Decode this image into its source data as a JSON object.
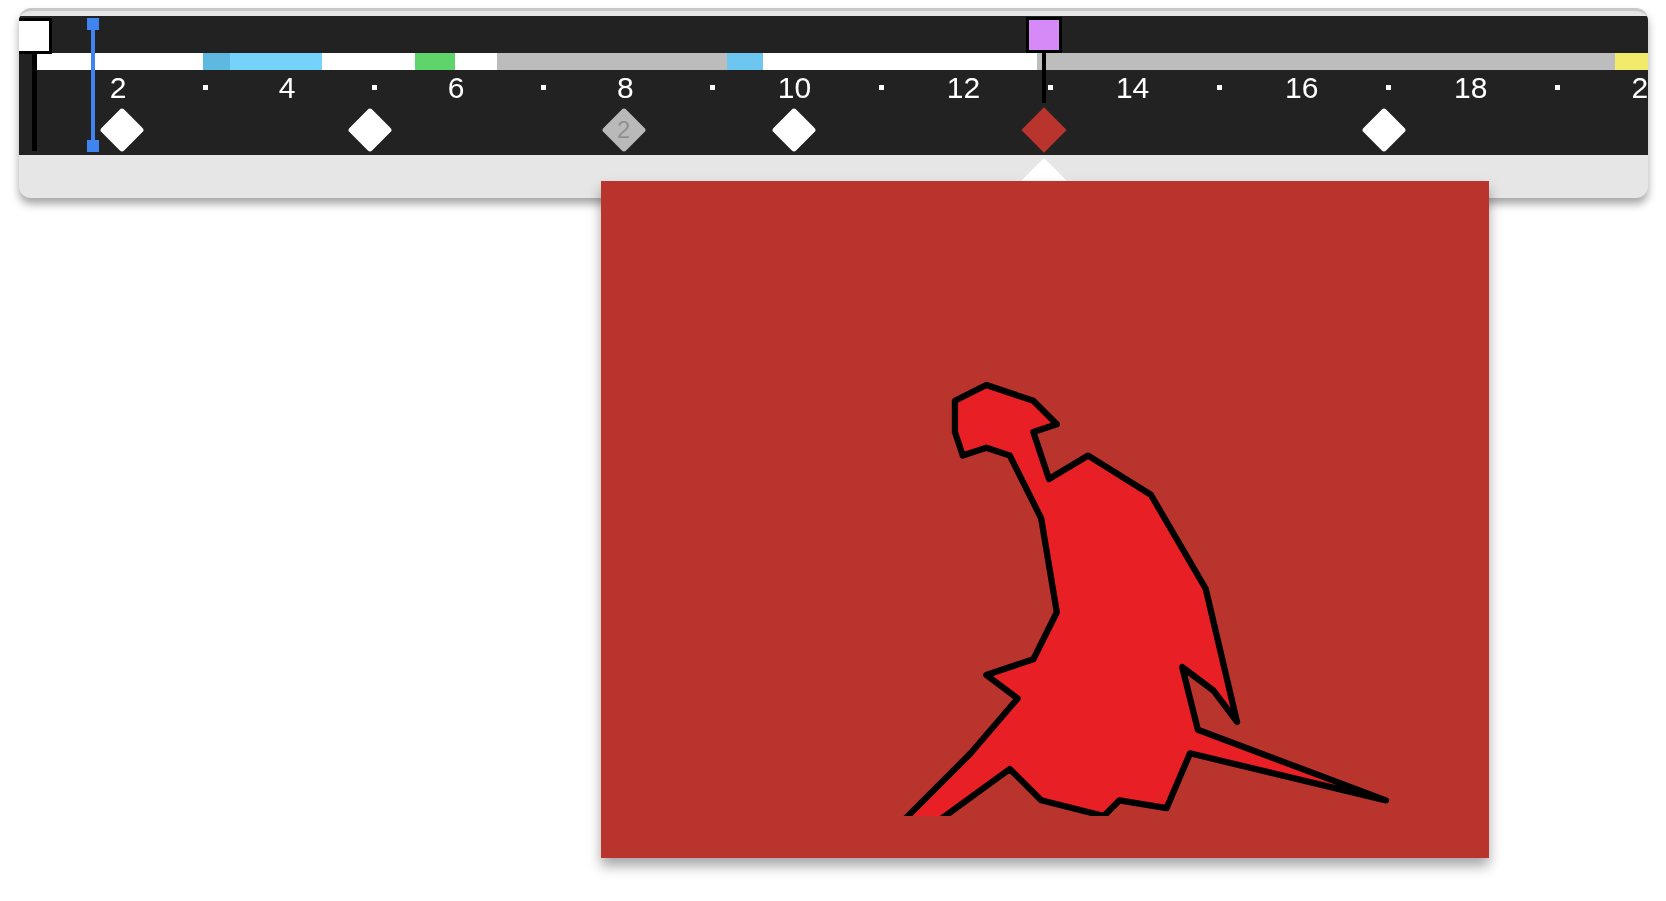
{
  "ruler": {
    "labels": [
      "2",
      "4",
      "6",
      "8",
      "10",
      "12",
      "14",
      "16",
      "18",
      "2"
    ]
  },
  "keyframes": [
    {
      "kind": "plain",
      "selected": false
    },
    {
      "kind": "plain",
      "selected": false
    },
    {
      "kind": "group",
      "label": "2",
      "selected": false
    },
    {
      "kind": "plain",
      "selected": false
    },
    {
      "kind": "plain",
      "selected": true
    },
    {
      "kind": "plain",
      "selected": false
    }
  ],
  "preview": {
    "kind": "illustration"
  }
}
